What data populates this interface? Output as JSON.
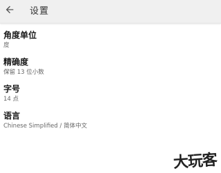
{
  "toolbar": {
    "back_icon": "arrow-left-icon",
    "title": "设置"
  },
  "settings": [
    {
      "title": "角度单位",
      "summary": "度"
    },
    {
      "title": "精确度",
      "summary": "保留 13 位小数"
    },
    {
      "title": "字号",
      "summary": "14 点"
    },
    {
      "title": "语言",
      "summary": "Chinese Simplified / 简体中文"
    }
  ],
  "watermark": {
    "text": "大玩客"
  }
}
